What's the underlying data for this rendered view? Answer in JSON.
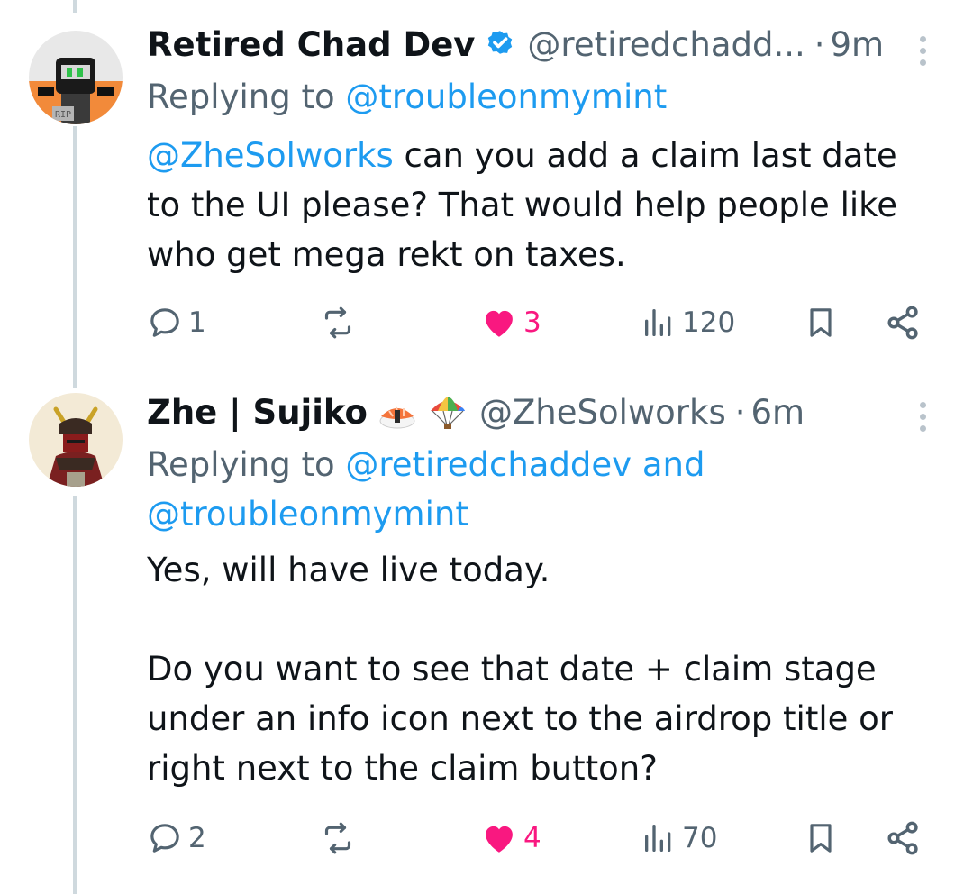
{
  "tweets": [
    {
      "author": "Retired Chad Dev",
      "handle": "@retiredchadd...",
      "separator": "·",
      "time": "9m",
      "reply_prefix": "Replying to",
      "reply_mentions": "@troubleonmymint",
      "mention": "@ZheSolworks",
      "text": " can you add a claim last date to the UI please? That would help people like who get mega rekt on taxes.",
      "verified": true,
      "stats": {
        "replies": "1",
        "reposts": "",
        "likes": "3",
        "views": "120"
      },
      "liked": true
    },
    {
      "author": "Zhe | Sujiko",
      "handle": "@ZheSolworks",
      "separator": "·",
      "time": "6m",
      "reply_prefix": "Replying to",
      "reply_mentions": "@retiredchaddev and @troubleonmymint",
      "text": "Yes, will have live today.\n\nDo you want to see that date + claim stage under an info icon next to the airdrop title or right next to the claim button?",
      "emojis": [
        "sushi-icon",
        "parachute-icon"
      ],
      "stats": {
        "replies": "2",
        "reposts": "",
        "likes": "4",
        "views": "70"
      },
      "liked": true
    }
  ],
  "colors": {
    "link": "#1d9bf0",
    "like": "#f91880",
    "secondary": "#536471",
    "text": "#0f1419",
    "thread": "#cfd9de"
  }
}
